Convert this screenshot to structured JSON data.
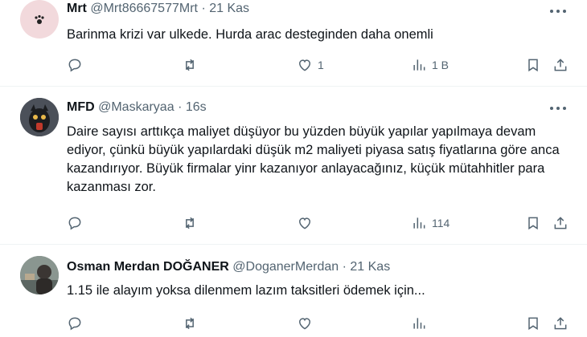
{
  "tweets": [
    {
      "name": "Mrt",
      "handle": "@Mrt86667577Mrt",
      "dot": "·",
      "time": "21 Kas",
      "text": "Barinma krizi var ulkede. Hurda arac desteginden daha onemli",
      "reply_count": "",
      "retweet_count": "",
      "like_count": "1",
      "view_count": "1 B"
    },
    {
      "name": "MFD",
      "handle": "@Maskaryaa",
      "dot": "·",
      "time": "16s",
      "text": "Daire sayısı arttıkça maliyet düşüyor bu yüzden büyük yapılar yapılmaya devam ediyor, çünkü büyük yapılardaki düşük m2 maliyeti piyasa satış fiyatlarına göre anca kazandırıyor. Büyük firmalar yinr kazanıyor anlayacağınız, küçük mütahhitler para kazanması zor.",
      "reply_count": "",
      "retweet_count": "",
      "like_count": "",
      "view_count": "114"
    },
    {
      "name": "Osman Merdan DOĞANER",
      "handle": "@DoganerMerdan",
      "dot": "·",
      "time": "21 Kas",
      "text": "1.15 ile alayım yoksa dilenmem lazım taksitleri ödemek için...",
      "reply_count": "",
      "retweet_count": "",
      "like_count": "",
      "view_count": ""
    }
  ],
  "icons": {
    "reply": "reply-icon",
    "retweet": "retweet-icon",
    "like": "heart-icon",
    "views": "views-icon",
    "bookmark": "bookmark-icon",
    "share": "share-icon",
    "more": "more-icon"
  },
  "colors": {
    "secondary_text": "#536471",
    "divider": "#eff3f4"
  }
}
